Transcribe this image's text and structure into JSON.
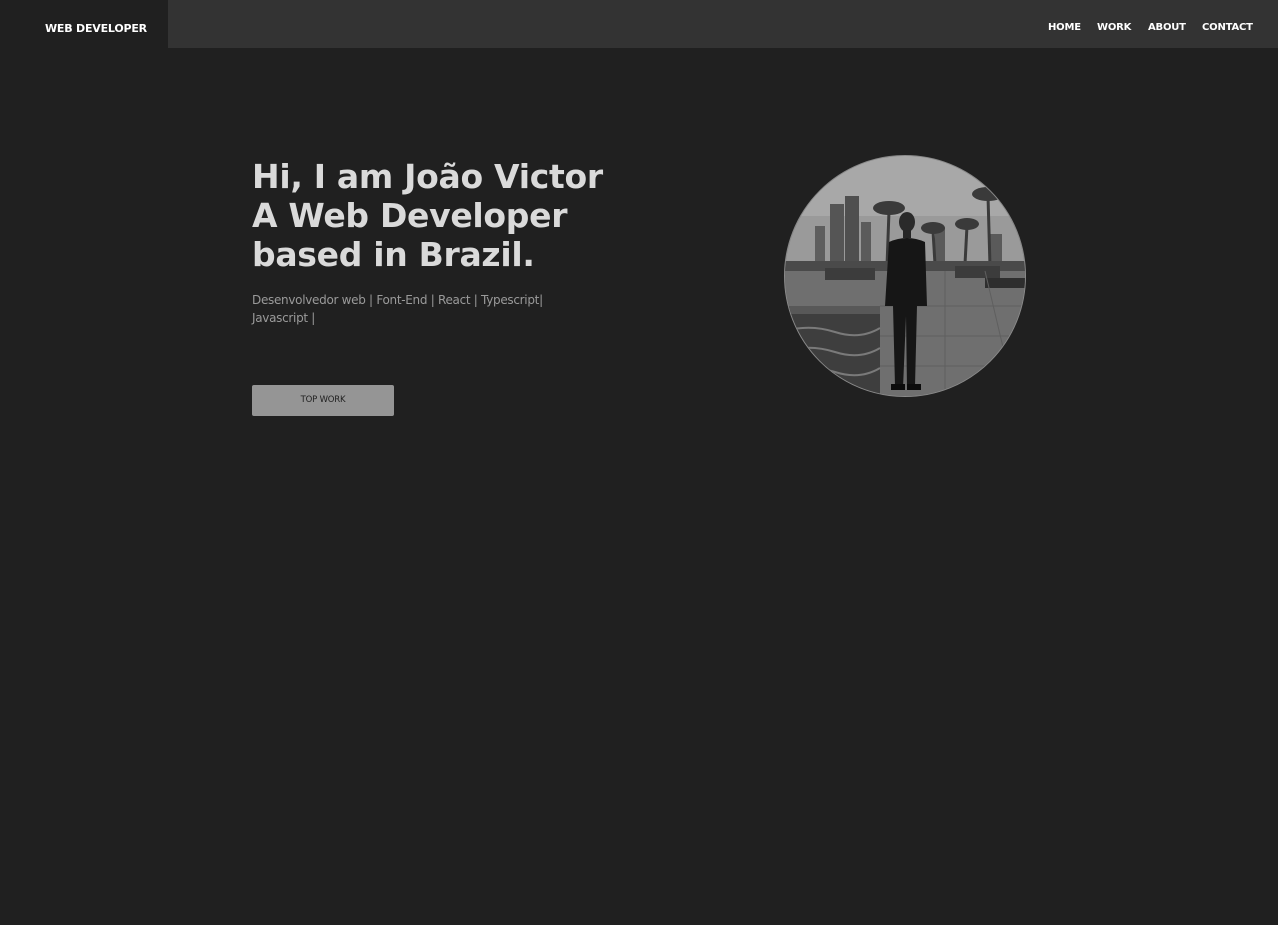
{
  "header": {
    "brand": "WEB DEVELOPER",
    "nav": {
      "home": "HOME",
      "work": "WORK",
      "about": "ABOUT",
      "contact": "CONTACT"
    }
  },
  "hero": {
    "title_lines": [
      "Hi, I am João Victor",
      "A Web Developer",
      "based in Brazil."
    ],
    "subtitle": "Desenvolvedor web | Font-End | React | Typescript| Javascript |",
    "cta_label": "TOP WORK",
    "avatar_alt": "avatar-photo"
  },
  "colors": {
    "background": "#202020",
    "header_bar": "#333333",
    "title": "#dadada",
    "subtitle": "#9a9a9a",
    "button": "#959595"
  }
}
